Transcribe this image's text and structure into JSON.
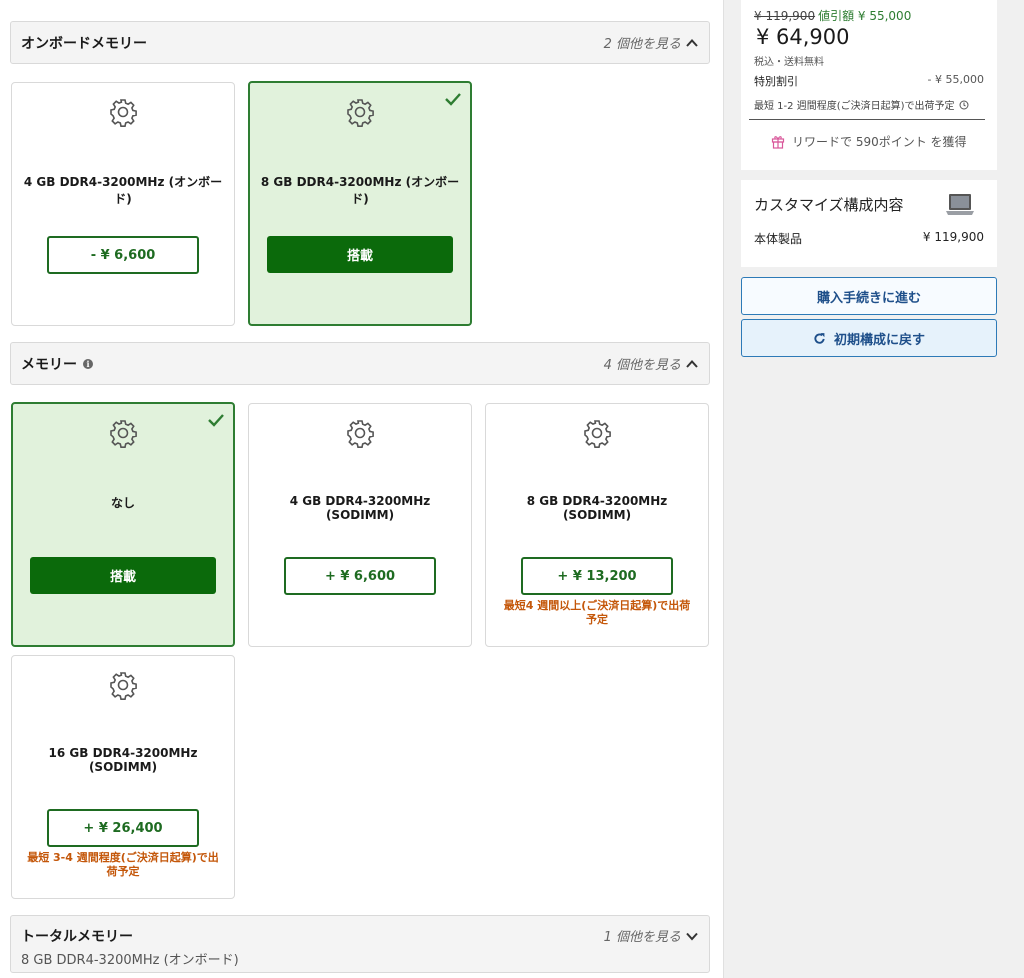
{
  "onboard_section": {
    "title": "オンボードメモリー",
    "more": "2 個他を見る",
    "options": [
      {
        "name": "4 GB DDR4-3200MHz (オンボード)",
        "price": "- ¥ 6,600",
        "selected": false
      },
      {
        "name": "8 GB DDR4-3200MHz (オンボード)",
        "button": "搭載",
        "selected": true
      }
    ]
  },
  "memory_section": {
    "title": "メモリー",
    "more": "4 個他を見る",
    "options": [
      {
        "name": "なし",
        "button": "搭載",
        "selected": true
      },
      {
        "name": "4 GB DDR4-3200MHz (SODIMM)",
        "price": "+ ¥ 6,600",
        "selected": false
      },
      {
        "name": "8 GB DDR4-3200MHz (SODIMM)",
        "price": "+ ¥ 13,200",
        "note": "最短4 週間以上(ご決済日起算)で出荷予定",
        "selected": false
      },
      {
        "name": "16 GB DDR4-3200MHz (SODIMM)",
        "price": "+ ¥ 26,400",
        "note": "最短 3-4 週間程度(ご決済日起算)で出荷予定",
        "selected": false
      }
    ]
  },
  "total_section": {
    "title": "トータルメモリー",
    "more": "1 個他を見る",
    "value": "8 GB DDR4-3200MHz (オンボード)"
  },
  "sidebar": {
    "old_price": "¥ 119,900",
    "discount_label": "値引額 ¥ 55,000",
    "price": "¥ 64,900",
    "tax_note": "税込・送料無料",
    "special_discount_label": "特別割引",
    "special_discount_value": "- ¥ 55,000",
    "shipping_note": "最短 1-2 週間程度(ご決済日起算)で出荷予定",
    "reward": "リワードで 590ポイント を獲得",
    "custom_title": "カスタマイズ構成内容",
    "body_label": "本体製品",
    "body_value": "¥ 119,900",
    "proceed_button": "購入手続きに進む",
    "reset_button": "初期構成に戻す"
  },
  "colors": {
    "selected_bg": "#e1f2dc",
    "accent_green": "#0b6a0b",
    "note_orange": "#c4570a",
    "link_blue": "#1e4f8a"
  },
  "icons": [
    "gear-icon",
    "check-icon",
    "chevron-up-icon",
    "chevron-down-icon",
    "info-icon",
    "clock-icon",
    "gift-icon",
    "laptop-icon",
    "reset-icon"
  ]
}
